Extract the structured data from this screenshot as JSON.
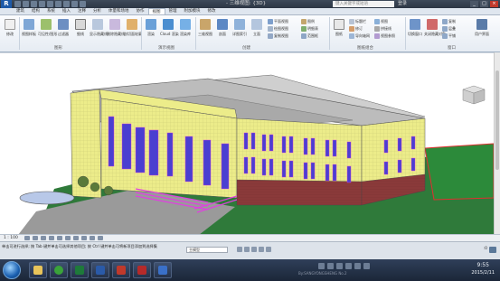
{
  "titlebar": {
    "app_button": "R",
    "title": "- 三维视图: {3D}",
    "search_placeholder": "键入关键字或短语",
    "login": "登录"
  },
  "tabs": [
    "建筑",
    "结构",
    "系统",
    "插入",
    "注释",
    "分析",
    "体量和场地",
    "协作",
    "视图",
    "管理",
    "附加模块",
    "修改"
  ],
  "active_tab": "视图",
  "ribbon": {
    "modify": "修改",
    "view_templates": "视图样板",
    "visibility": "可见性/图形",
    "filters": "过滤器",
    "thin_lines": "细线",
    "show_hidden": "显示隐藏线",
    "remove_hidden": "删除隐藏线",
    "cut_profile": "剖切面轮廓",
    "render": "渲染",
    "cloud_render": "Cloud 渲染",
    "render_gallery": "渲染库",
    "three_d_view": "三维视图",
    "section": "剖面",
    "callout": "详图索引",
    "elevation": "立面",
    "plan_views": "平面视图",
    "drafting_view": "绘图视图",
    "duplicate_view": "复制视图",
    "legends": "图例",
    "schedules": "明细表",
    "scope_box": "范围框",
    "sheet": "图纸",
    "title_block": "标题栏",
    "revisions": "修订",
    "guide_grid": "导向轴网",
    "view": "视图",
    "matchline": "拼接线",
    "view_reference": "视图参照",
    "switch_windows": "切换窗口",
    "close_hidden": "关闭隐藏对象",
    "replicate": "复制",
    "cascade": "层叠",
    "tile": "平铺",
    "user_interface": "用户界面",
    "panel_graphics": "图形",
    "panel_presentation": "演示视图",
    "panel_create": "创建",
    "panel_sheet": "图纸组合",
    "panel_windows": "窗口"
  },
  "viewbar": {
    "scale": "1 : 100"
  },
  "statusbar": {
    "message": "单击可进行选择; 按 Tab 键并单击可选择其他项目; 按 Ctrl 键并单击可将新项目添加到选择集",
    "model": "主模型",
    "filter_count": ":0"
  },
  "taskbar": {
    "ghost_text": "By:SANGYONGSHENG No.2",
    "time": "9:55",
    "date": "2015/2/11"
  },
  "colors": {
    "facade": "#ecec8a",
    "brick": "#8a3a3a",
    "window": "#4a3fd0",
    "magenta": "#e040e0",
    "grass": "#2f7a3a",
    "roof": "#b8b8b8"
  }
}
